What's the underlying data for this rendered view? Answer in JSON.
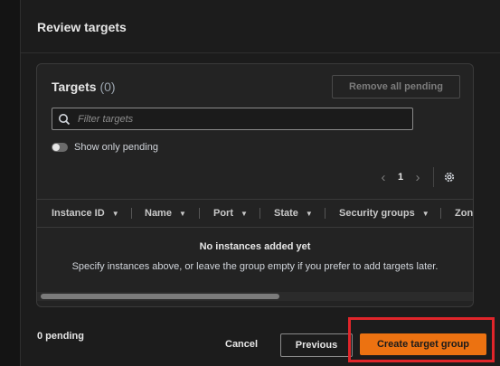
{
  "header": {
    "title": "Review targets"
  },
  "targets": {
    "title": "Targets",
    "count": "(0)",
    "remove_all_label": "Remove all pending",
    "search_placeholder": "Filter targets",
    "toggle_label": "Show only pending",
    "page_number": "1",
    "columns": [
      "Instance ID",
      "Name",
      "Port",
      "State",
      "Security groups",
      "Zon"
    ],
    "empty_title": "No instances added yet",
    "empty_description": "Specify instances above, or leave the group empty if you prefer to add targets later.",
    "scroll_position": 0.0
  },
  "footer": {
    "pending_text": "0 pending",
    "cancel_label": "Cancel",
    "previous_label": "Previous",
    "create_label": "Create target group"
  },
  "colors": {
    "primary_button": "#ec7211",
    "highlight_box": "#e0252a",
    "panel_bg": "#1c1c1c"
  },
  "icons": [
    "search-icon",
    "chevron-left-icon",
    "chevron-right-icon",
    "gear-icon",
    "caret-down-icon",
    "toggle-switch"
  ]
}
